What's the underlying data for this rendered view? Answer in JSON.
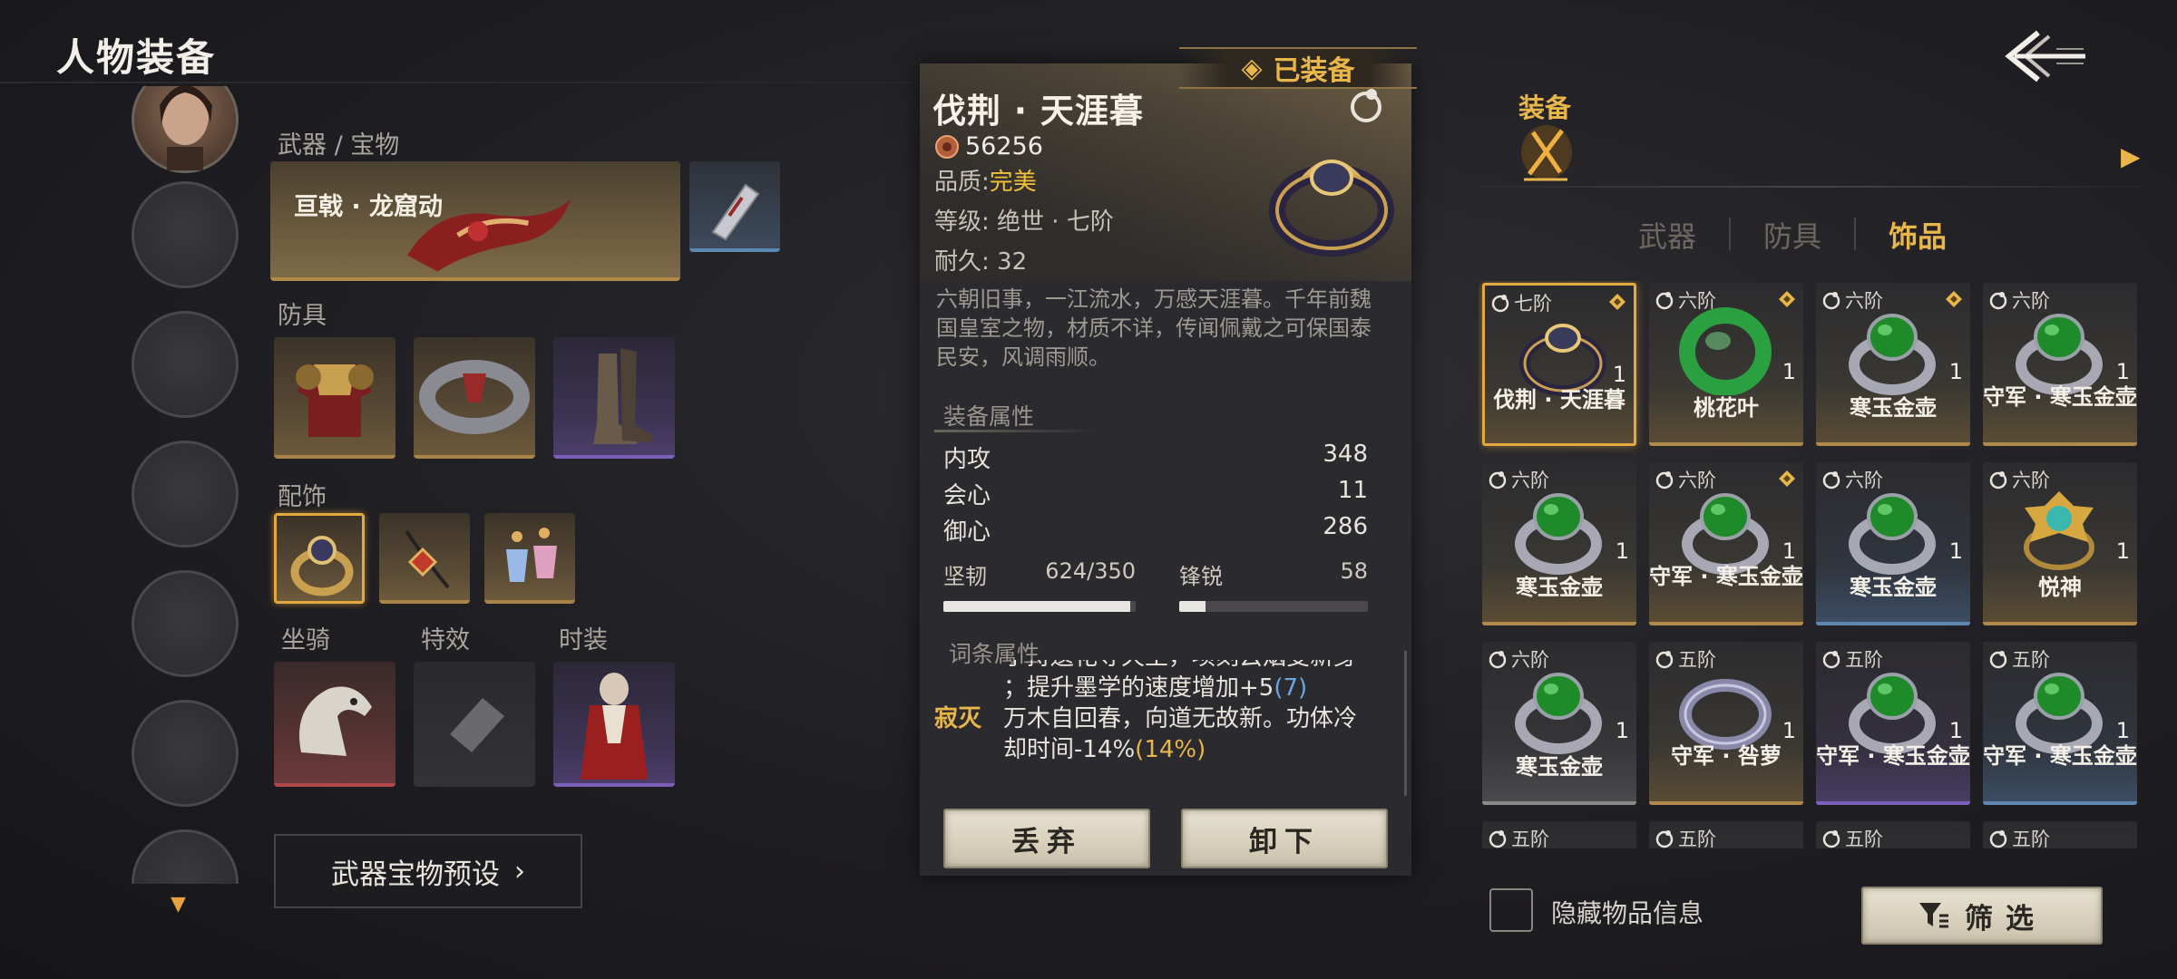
{
  "header": {
    "title": "人物装备"
  },
  "left": {
    "weapon_section": "武器 / 宝物",
    "weapon_name": "亘戟 · 龙窟动",
    "armor_section": "防具",
    "accessory_section": "配饰",
    "mount_section": "坐骑",
    "effect_section": "特效",
    "fashion_section": "时装",
    "preset_button": "武器宝物预设"
  },
  "detail": {
    "equipped_tag": "已装备",
    "name": "伐荆 · 天涯暮",
    "coin_value": "56256",
    "quality_label": "品质:",
    "quality_value": "完美",
    "grade": "等级: 绝世 · 七阶",
    "durability": "耐久: 32",
    "description": "六朝旧事，一江流水，万感天涯暮。千年前魏国皇室之物，材质不详，传闻佩戴之可保国泰民安，风调雨顺。",
    "attr_heading": "装备属性",
    "stats": [
      {
        "name": "内攻",
        "value": "348"
      },
      {
        "name": "会心",
        "value": "11"
      },
      {
        "name": "御心",
        "value": "286"
      }
    ],
    "bars": [
      {
        "name": "坚韧",
        "value": "624/350",
        "fill": 0.97
      },
      {
        "name": "锋锐",
        "value": "58",
        "fill": 0.14
      }
    ],
    "affix_heading": "词条属性",
    "affix_partial_1": "手持遗花寺天土，项刻云烟变新身",
    "affix_partial_2": "；提升墨学的速度增加+5",
    "affix_partial_2_num": "(7)",
    "affix_name": "寂灭",
    "affix_text_1": "万木自回春，向道无故新。功体冷",
    "affix_text_2": "却时间-14%",
    "affix_text_2_num": "(14%)",
    "discard_button": "丢弃",
    "unequip_button": "卸下"
  },
  "right": {
    "equip_tab": "装备",
    "categories": [
      "武器",
      "防具",
      "饰品"
    ],
    "active_category": "饰品",
    "items": [
      {
        "tier": "七阶",
        "name": "伐荆 · 天涯暮",
        "count": "1",
        "diamond": true,
        "rarity": "g",
        "selected": true
      },
      {
        "tier": "六阶",
        "name": "桃花叶",
        "count": "1",
        "diamond": true,
        "rarity": "g"
      },
      {
        "tier": "六阶",
        "name": "寒玉金壶",
        "count": "1",
        "diamond": true,
        "rarity": "g"
      },
      {
        "tier": "六阶",
        "name": "守军 · 寒玉金壶",
        "count": "1",
        "diamond": false,
        "rarity": "g"
      },
      {
        "tier": "六阶",
        "name": "寒玉金壶",
        "count": "1",
        "diamond": false,
        "rarity": "g"
      },
      {
        "tier": "六阶",
        "name": "守军 · 寒玉金壶",
        "count": "1",
        "diamond": true,
        "rarity": "g"
      },
      {
        "tier": "六阶",
        "name": "寒玉金壶",
        "count": "1",
        "diamond": false,
        "rarity": "b"
      },
      {
        "tier": "六阶",
        "name": "悦神",
        "count": "1",
        "diamond": false,
        "rarity": "g"
      },
      {
        "tier": "六阶",
        "name": "寒玉金壶",
        "count": "1",
        "diamond": false,
        "rarity": "w"
      },
      {
        "tier": "五阶",
        "name": "守军 · 咎萝",
        "count": "1",
        "diamond": false,
        "rarity": "g"
      },
      {
        "tier": "五阶",
        "name": "守军 · 寒玉金壶",
        "count": "1",
        "diamond": false,
        "rarity": "p"
      },
      {
        "tier": "五阶",
        "name": "守军 · 寒玉金壶",
        "count": "1",
        "diamond": false,
        "rarity": "b"
      },
      {
        "tier": "五阶",
        "name": "",
        "count": "",
        "diamond": false,
        "rarity": "w"
      },
      {
        "tier": "五阶",
        "name": "",
        "count": "",
        "diamond": false,
        "rarity": "w"
      },
      {
        "tier": "五阶",
        "name": "",
        "count": "",
        "diamond": false,
        "rarity": "w"
      },
      {
        "tier": "五阶",
        "name": "",
        "count": "",
        "diamond": false,
        "rarity": "w"
      }
    ],
    "hide_info_label": "隐藏物品信息",
    "filter_button": "筛选"
  },
  "colors": {
    "accent_gold": "#e8b64a",
    "quality_gold": "#f0c23c",
    "affix_blue": "#6ba7e2"
  }
}
